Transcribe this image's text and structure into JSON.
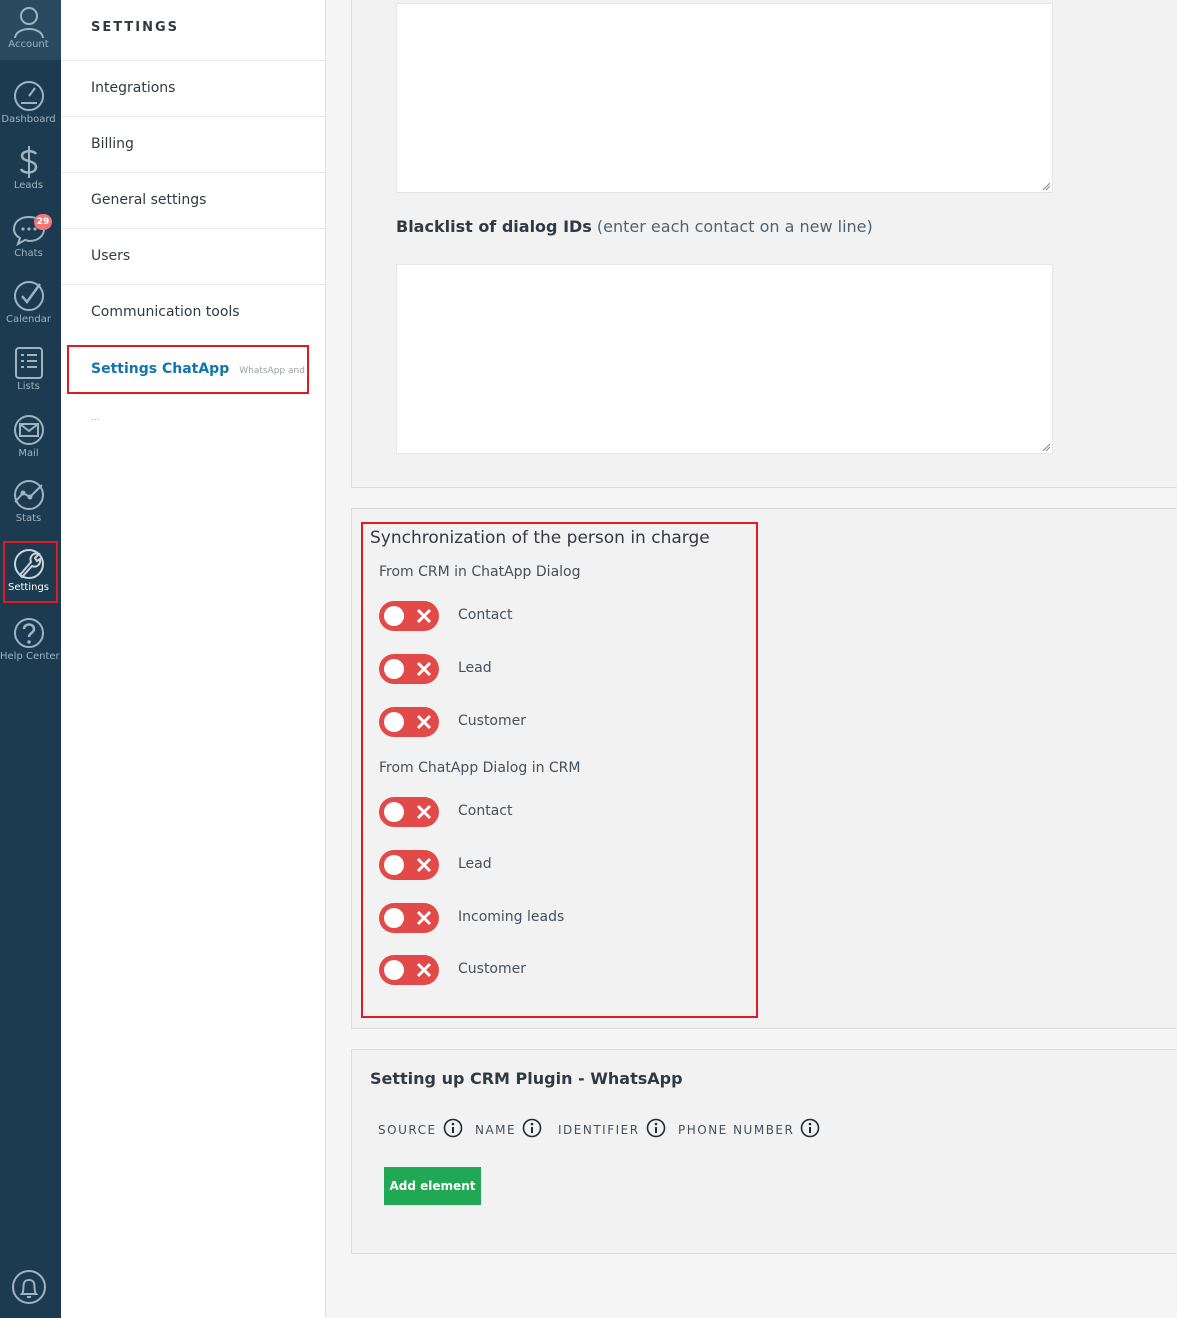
{
  "nav": {
    "account": "Account",
    "items": [
      {
        "label": "Dashboard",
        "icon": "dashboard-icon"
      },
      {
        "label": "Leads",
        "icon": "dollar-icon"
      },
      {
        "label": "Chats",
        "icon": "chat-icon",
        "badge": "29"
      },
      {
        "label": "Calendar",
        "icon": "calendar-check-icon"
      },
      {
        "label": "Lists",
        "icon": "list-icon"
      },
      {
        "label": "Mail",
        "icon": "mail-icon"
      },
      {
        "label": "Stats",
        "icon": "stats-icon"
      },
      {
        "label": "Settings",
        "icon": "wrench-icon",
        "active": true
      },
      {
        "label": "Help Center",
        "icon": "help-icon"
      }
    ],
    "bell_icon": "bell-icon"
  },
  "menu": {
    "title": "SETTINGS",
    "items": [
      {
        "label": "Integrations"
      },
      {
        "label": "Billing"
      },
      {
        "label": "General settings"
      },
      {
        "label": "Users"
      },
      {
        "label": "Communication tools"
      },
      {
        "label": "Settings ChatApp",
        "sub": "WhatsApp and ...",
        "active": true
      }
    ]
  },
  "blacklist": {
    "title": "Blacklist of dialog IDs",
    "hint": "(enter each contact on a new line)",
    "value": ""
  },
  "sync": {
    "title": "Synchronization of the person in charge",
    "from_crm": {
      "heading": "From CRM in ChatApp Dialog",
      "toggles": [
        {
          "label": "Contact",
          "enabled": false
        },
        {
          "label": "Lead",
          "enabled": false
        },
        {
          "label": "Customer",
          "enabled": false
        }
      ]
    },
    "from_chatapp": {
      "heading": "From ChatApp Dialog in CRM",
      "toggles": [
        {
          "label": "Contact",
          "enabled": false
        },
        {
          "label": "Lead",
          "enabled": false
        },
        {
          "label": "Incoming leads",
          "enabled": false
        },
        {
          "label": "Customer",
          "enabled": false
        }
      ]
    }
  },
  "crm_plugin": {
    "title": "Setting up CRM Plugin - WhatsApp",
    "columns": [
      "SOURCE",
      "NAME",
      "IDENTIFIER",
      "PHONE NUMBER"
    ],
    "add_button": "Add element"
  },
  "colors": {
    "nav_bg": "#1c3b50",
    "highlight": "#e11b22",
    "toggle_off": "#e14a48",
    "button_green": "#20a854",
    "active_link": "#1375ab"
  }
}
